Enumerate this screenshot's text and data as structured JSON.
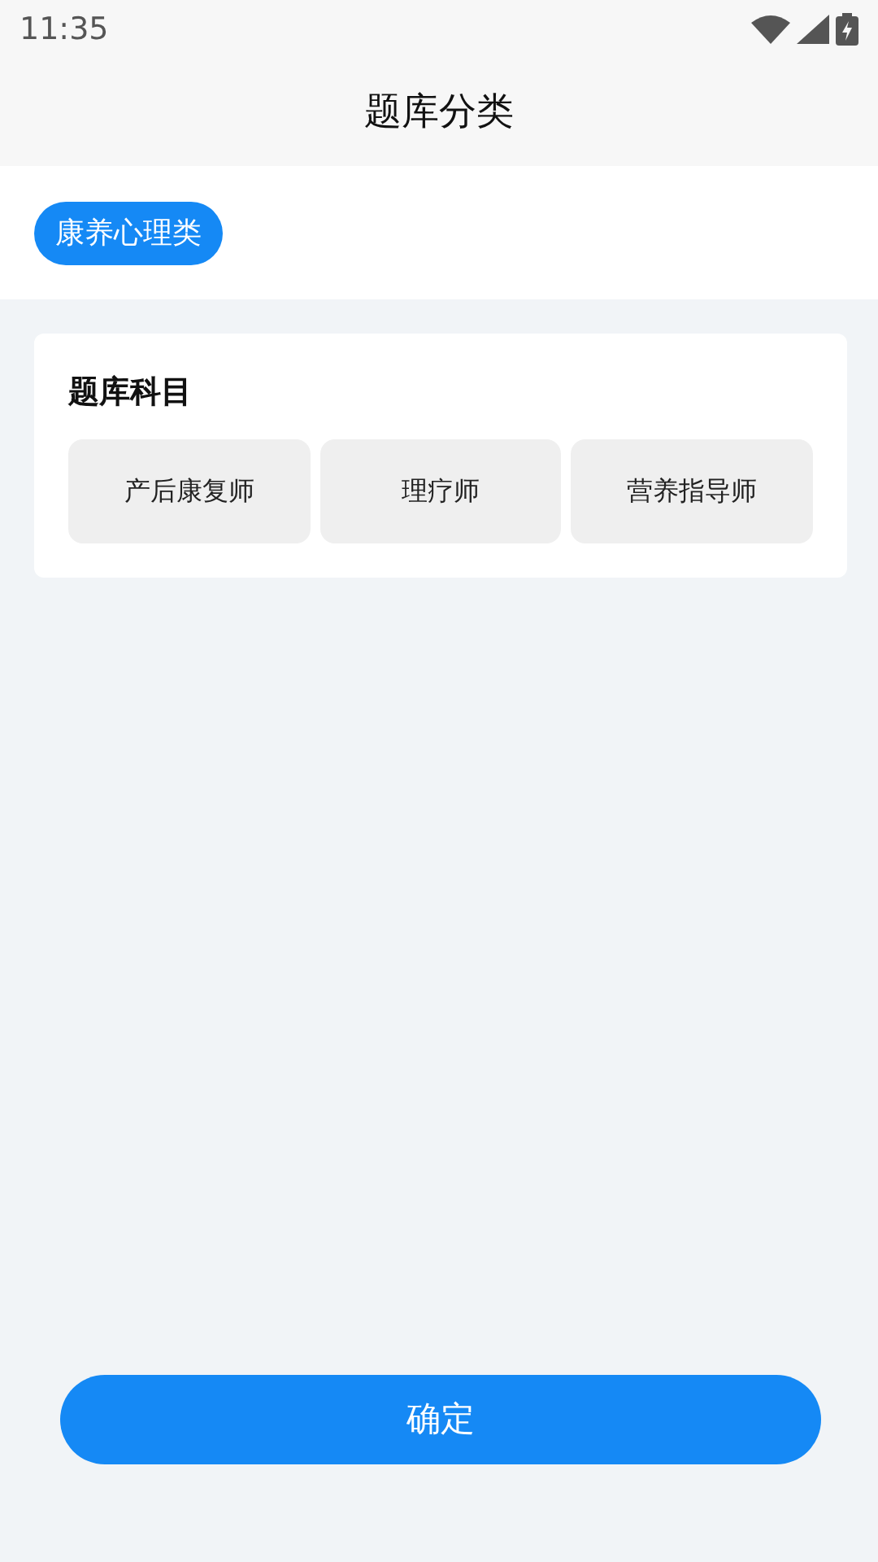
{
  "status_bar": {
    "time": "11:35"
  },
  "header": {
    "title": "题库分类"
  },
  "categories": [
    {
      "label": "康养心理类",
      "selected": true
    }
  ],
  "subjects": {
    "title": "题库科目",
    "items": [
      {
        "label": "产后康复师",
        "selected": false
      },
      {
        "label": "理疗师",
        "selected": false
      },
      {
        "label": "营养指导师",
        "selected": false
      }
    ]
  },
  "confirm_button": "确定"
}
